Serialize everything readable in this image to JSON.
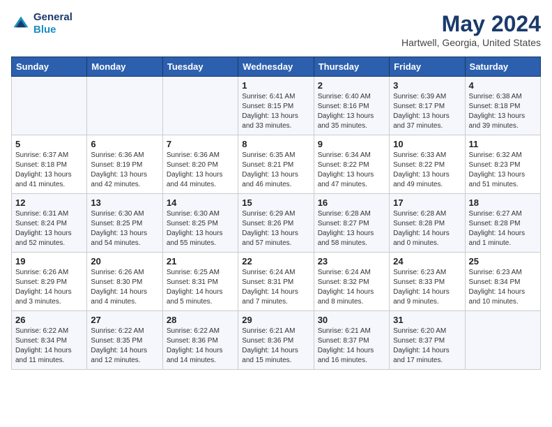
{
  "header": {
    "logo_line1": "General",
    "logo_line2": "Blue",
    "title": "May 2024",
    "subtitle": "Hartwell, Georgia, United States"
  },
  "days_of_week": [
    "Sunday",
    "Monday",
    "Tuesday",
    "Wednesday",
    "Thursday",
    "Friday",
    "Saturday"
  ],
  "weeks": [
    [
      {
        "day": "",
        "info": ""
      },
      {
        "day": "",
        "info": ""
      },
      {
        "day": "",
        "info": ""
      },
      {
        "day": "1",
        "info": "Sunrise: 6:41 AM\nSunset: 8:15 PM\nDaylight: 13 hours\nand 33 minutes."
      },
      {
        "day": "2",
        "info": "Sunrise: 6:40 AM\nSunset: 8:16 PM\nDaylight: 13 hours\nand 35 minutes."
      },
      {
        "day": "3",
        "info": "Sunrise: 6:39 AM\nSunset: 8:17 PM\nDaylight: 13 hours\nand 37 minutes."
      },
      {
        "day": "4",
        "info": "Sunrise: 6:38 AM\nSunset: 8:18 PM\nDaylight: 13 hours\nand 39 minutes."
      }
    ],
    [
      {
        "day": "5",
        "info": "Sunrise: 6:37 AM\nSunset: 8:18 PM\nDaylight: 13 hours\nand 41 minutes."
      },
      {
        "day": "6",
        "info": "Sunrise: 6:36 AM\nSunset: 8:19 PM\nDaylight: 13 hours\nand 42 minutes."
      },
      {
        "day": "7",
        "info": "Sunrise: 6:36 AM\nSunset: 8:20 PM\nDaylight: 13 hours\nand 44 minutes."
      },
      {
        "day": "8",
        "info": "Sunrise: 6:35 AM\nSunset: 8:21 PM\nDaylight: 13 hours\nand 46 minutes."
      },
      {
        "day": "9",
        "info": "Sunrise: 6:34 AM\nSunset: 8:22 PM\nDaylight: 13 hours\nand 47 minutes."
      },
      {
        "day": "10",
        "info": "Sunrise: 6:33 AM\nSunset: 8:22 PM\nDaylight: 13 hours\nand 49 minutes."
      },
      {
        "day": "11",
        "info": "Sunrise: 6:32 AM\nSunset: 8:23 PM\nDaylight: 13 hours\nand 51 minutes."
      }
    ],
    [
      {
        "day": "12",
        "info": "Sunrise: 6:31 AM\nSunset: 8:24 PM\nDaylight: 13 hours\nand 52 minutes."
      },
      {
        "day": "13",
        "info": "Sunrise: 6:30 AM\nSunset: 8:25 PM\nDaylight: 13 hours\nand 54 minutes."
      },
      {
        "day": "14",
        "info": "Sunrise: 6:30 AM\nSunset: 8:25 PM\nDaylight: 13 hours\nand 55 minutes."
      },
      {
        "day": "15",
        "info": "Sunrise: 6:29 AM\nSunset: 8:26 PM\nDaylight: 13 hours\nand 57 minutes."
      },
      {
        "day": "16",
        "info": "Sunrise: 6:28 AM\nSunset: 8:27 PM\nDaylight: 13 hours\nand 58 minutes."
      },
      {
        "day": "17",
        "info": "Sunrise: 6:28 AM\nSunset: 8:28 PM\nDaylight: 14 hours\nand 0 minutes."
      },
      {
        "day": "18",
        "info": "Sunrise: 6:27 AM\nSunset: 8:28 PM\nDaylight: 14 hours\nand 1 minute."
      }
    ],
    [
      {
        "day": "19",
        "info": "Sunrise: 6:26 AM\nSunset: 8:29 PM\nDaylight: 14 hours\nand 3 minutes."
      },
      {
        "day": "20",
        "info": "Sunrise: 6:26 AM\nSunset: 8:30 PM\nDaylight: 14 hours\nand 4 minutes."
      },
      {
        "day": "21",
        "info": "Sunrise: 6:25 AM\nSunset: 8:31 PM\nDaylight: 14 hours\nand 5 minutes."
      },
      {
        "day": "22",
        "info": "Sunrise: 6:24 AM\nSunset: 8:31 PM\nDaylight: 14 hours\nand 7 minutes."
      },
      {
        "day": "23",
        "info": "Sunrise: 6:24 AM\nSunset: 8:32 PM\nDaylight: 14 hours\nand 8 minutes."
      },
      {
        "day": "24",
        "info": "Sunrise: 6:23 AM\nSunset: 8:33 PM\nDaylight: 14 hours\nand 9 minutes."
      },
      {
        "day": "25",
        "info": "Sunrise: 6:23 AM\nSunset: 8:34 PM\nDaylight: 14 hours\nand 10 minutes."
      }
    ],
    [
      {
        "day": "26",
        "info": "Sunrise: 6:22 AM\nSunset: 8:34 PM\nDaylight: 14 hours\nand 11 minutes."
      },
      {
        "day": "27",
        "info": "Sunrise: 6:22 AM\nSunset: 8:35 PM\nDaylight: 14 hours\nand 12 minutes."
      },
      {
        "day": "28",
        "info": "Sunrise: 6:22 AM\nSunset: 8:36 PM\nDaylight: 14 hours\nand 14 minutes."
      },
      {
        "day": "29",
        "info": "Sunrise: 6:21 AM\nSunset: 8:36 PM\nDaylight: 14 hours\nand 15 minutes."
      },
      {
        "day": "30",
        "info": "Sunrise: 6:21 AM\nSunset: 8:37 PM\nDaylight: 14 hours\nand 16 minutes."
      },
      {
        "day": "31",
        "info": "Sunrise: 6:20 AM\nSunset: 8:37 PM\nDaylight: 14 hours\nand 17 minutes."
      },
      {
        "day": "",
        "info": ""
      }
    ]
  ]
}
